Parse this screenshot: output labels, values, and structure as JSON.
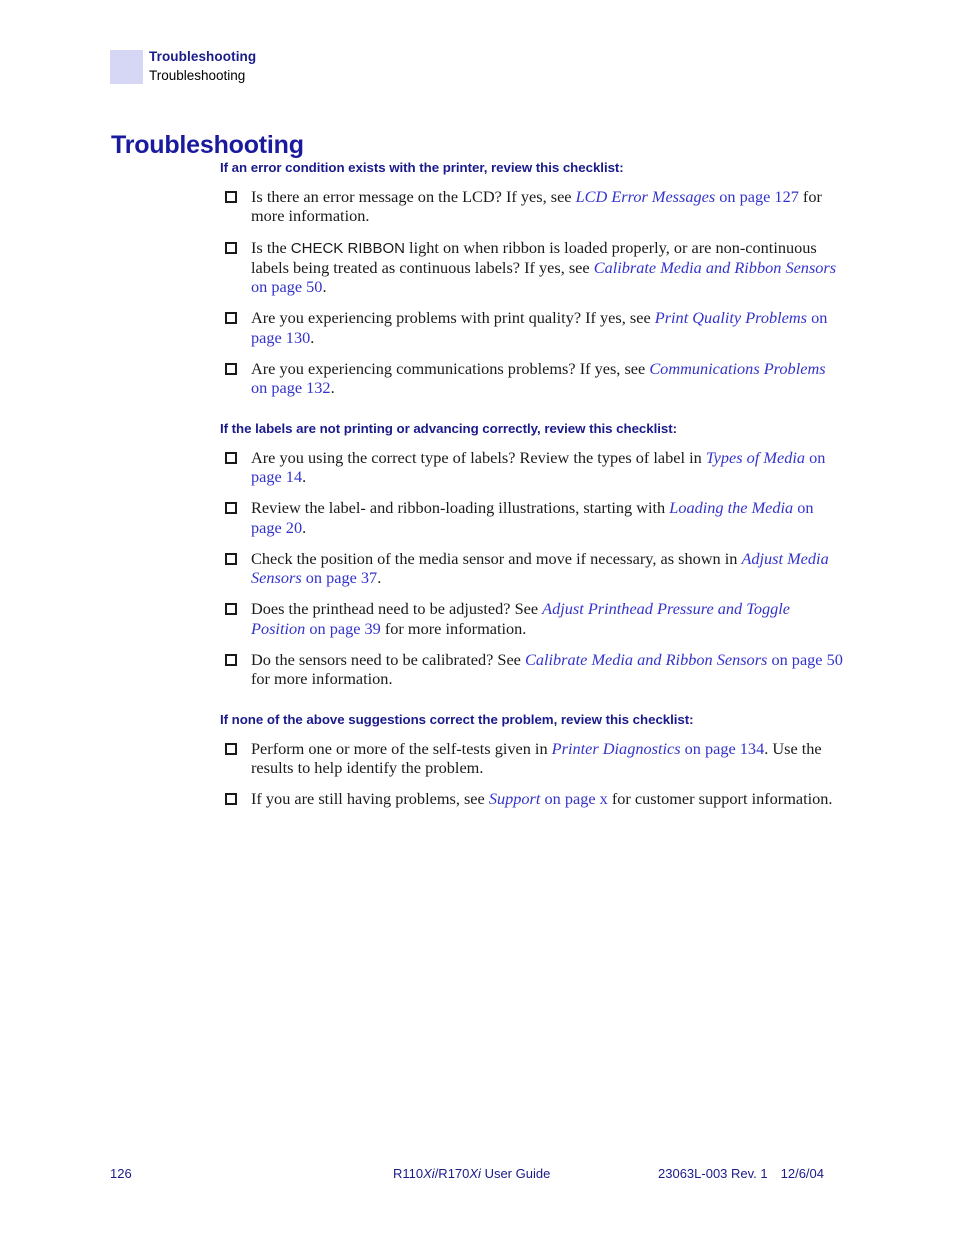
{
  "header": {
    "chapter": "Troubleshooting",
    "section": "Troubleshooting"
  },
  "title": "Troubleshooting",
  "sections": [
    {
      "heading": "If an error condition exists with the printer, review this checklist:",
      "items": [
        {
          "lead": "Is there an error message on the LCD? If yes, see ",
          "ref": "LCD Error Messages",
          "pageref": " on page 127",
          "tail": " for more information."
        },
        {
          "lead": "Is the ",
          "ui": "CHECK RIBBON",
          "mid": " light on when ribbon is loaded properly, or are non-continuous labels being treated as continuous labels? If yes, see ",
          "ref": "Calibrate Media and Ribbon Sensors",
          "pageref": " on page 50",
          "tail": "."
        },
        {
          "lead": "Are you experiencing problems with print quality? If yes, see ",
          "ref": "Print Quality Problems",
          "pageref": " on page 130",
          "tail": "."
        },
        {
          "lead": "Are you experiencing communications problems? If yes, see ",
          "ref": "Communications Problems",
          "pageref": " on page 132",
          "tail": "."
        }
      ]
    },
    {
      "heading": "If the labels are not printing or advancing correctly, review this checklist:",
      "items": [
        {
          "lead": "Are you using the correct type of labels? Review the types of label in ",
          "ref": "Types of Media",
          "pageref": " on page 14",
          "tail": "."
        },
        {
          "lead": "Review the label- and ribbon-loading illustrations, starting with ",
          "ref": "Loading the Media",
          "pageref": " on page 20",
          "tail": "."
        },
        {
          "lead": "Check the position of the media sensor and move if necessary, as shown in ",
          "ref": "Adjust Media Sensors",
          "pageref": " on page 37",
          "tail": "."
        },
        {
          "lead": "Does the printhead need to be adjusted? See ",
          "ref": "Adjust Printhead Pressure and Toggle Position",
          "pageref": " on page 39",
          "tail": " for more information."
        },
        {
          "lead": "Do the sensors need to be calibrated? See ",
          "ref": "Calibrate Media and Ribbon Sensors",
          "pageref": " on page 50",
          "tail": " for more information."
        }
      ]
    },
    {
      "heading": "If none of the above suggestions correct the problem, review this checklist:",
      "items": [
        {
          "lead": "Perform one or more of the self-tests given in ",
          "ref": "Printer Diagnostics",
          "pageref": " on page 134",
          "tail": ". Use the results to help identify the problem."
        },
        {
          "lead": "If you are still having problems, see ",
          "ref": "Support",
          "pageref": " on page x",
          "tail": " for customer support information."
        }
      ]
    }
  ],
  "footer": {
    "page_number": "126",
    "guide_prefix": "R110",
    "guide_xi_1": "Xi",
    "guide_middle": "/R170",
    "guide_xi_2": "Xi",
    "guide_suffix": " User Guide",
    "doc_number": "23063L-003 Rev. 1",
    "doc_date": "12/6/04"
  },
  "colors": {
    "heading_blue": "#1a1a8c",
    "title_blue": "#1a1a9e",
    "link_blue": "#3333cc",
    "swatch_lavender": "#d6d6f5",
    "body_text": "#1a1a1a"
  }
}
